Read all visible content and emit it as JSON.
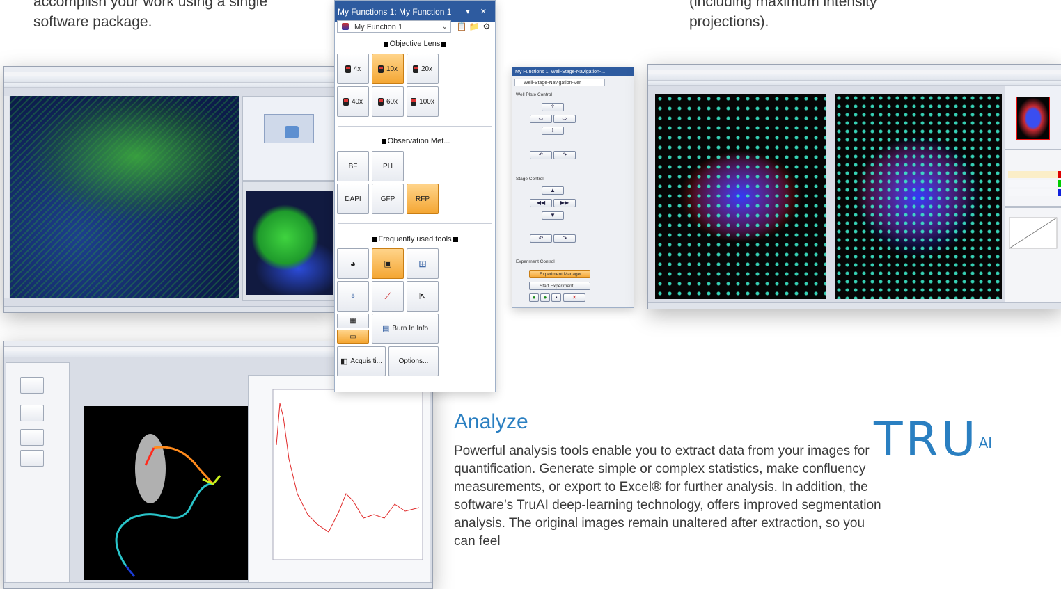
{
  "intro": {
    "left_text": "accomplish your work using a single software package.",
    "right_text": "(including maximum intensity projections)."
  },
  "function_panel": {
    "title": "My Functions 1: My Function 1",
    "window_controls": "▾ ✕",
    "selected_function": "My Function 1",
    "sections": {
      "objective": "Objective Lens",
      "observation": "Observation Met...",
      "tools": "Frequently used tools"
    },
    "objective_lenses": [
      "4x",
      "10x",
      "20x",
      "40x",
      "60x",
      "100x"
    ],
    "observation_methods": [
      "BF",
      "PH",
      "DAPI",
      "GFP",
      "RFP"
    ],
    "burn_in_label": "Burn In Info",
    "acquisition_label": "Acquisiti...",
    "options_label": "Options..."
  },
  "navigation_panel": {
    "title": "My Functions 1: Well-Stage-Navigation-...",
    "selected_function": "Well-Stage-Navigation-Ver",
    "well_plate_control": "Well Plate Control",
    "stage_control": "Stage Control",
    "experiment_control": "Experiment Control",
    "experiment_manager": "Experiment Manager",
    "start_experiment": "Start Experiment"
  },
  "analyze": {
    "heading": "Analyze",
    "body": "Powerful analysis tools enable you to extract data from your images for quantification. Generate simple or complex statistics, make confluency measurements, or export to Excel® for further analysis. In addition, the software’s TruAI deep-learning technology, offers improved segmentation analysis. The original images remain unaltered after extraction, so you can feel"
  },
  "logo": {
    "main": "TRU",
    "sup": "AI"
  },
  "colors": {
    "brand_blue": "#2a7fc1",
    "panel_title": "#2e5b9f",
    "active_orange": "#f4a633"
  }
}
